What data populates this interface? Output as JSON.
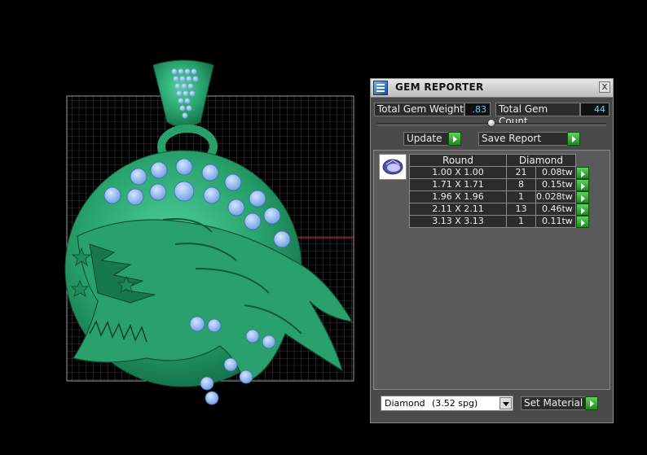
{
  "panel": {
    "title": "GEM REPORTER",
    "close_glyph": "x",
    "total_weight_label": "Total Gem Weight",
    "total_weight_value": ".83",
    "total_count_label": "Total Gem Count",
    "total_count_value": "44",
    "update_label": "Update",
    "save_report_label": "Save Report",
    "table": {
      "header_shape": "Round",
      "header_material": "Diamond",
      "rows": [
        {
          "size": "1.00 X 1.00",
          "count": "21",
          "weight": "0.08tw"
        },
        {
          "size": "1.71 X 1.71",
          "count": "8",
          "weight": "0.15tw"
        },
        {
          "size": "1.96 X 1.96",
          "count": "1",
          "weight": "0.028tw"
        },
        {
          "size": "2.11 X 2.11",
          "count": "13",
          "weight": "0.46tw"
        },
        {
          "size": "3.13 X 3.13",
          "count": "1",
          "weight": "0.11tw"
        }
      ]
    },
    "material_name": "Diamond",
    "material_spg": "(3.52 spg)",
    "set_material_label": "Set Material"
  },
  "colors": {
    "metal": "#2eaa74",
    "gem": "#8fb8f0",
    "value_text": "#58d6f0",
    "go_button": "#2fa52f"
  }
}
